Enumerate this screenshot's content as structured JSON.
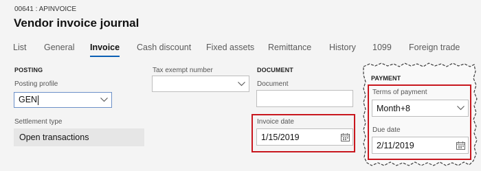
{
  "header": {
    "record_id": "00641 : APINVOICE",
    "title": "Vendor invoice journal"
  },
  "tabs": [
    {
      "label": "List",
      "active": false
    },
    {
      "label": "General",
      "active": false
    },
    {
      "label": "Invoice",
      "active": true
    },
    {
      "label": "Cash discount",
      "active": false
    },
    {
      "label": "Fixed assets",
      "active": false
    },
    {
      "label": "Remittance",
      "active": false
    },
    {
      "label": "History",
      "active": false
    },
    {
      "label": "1099",
      "active": false
    },
    {
      "label": "Foreign trade",
      "active": false
    }
  ],
  "posting": {
    "heading": "POSTING",
    "posting_profile_label": "Posting profile",
    "posting_profile_value": "GEN",
    "settlement_type_label": "Settlement type",
    "settlement_type_value": "Open transactions"
  },
  "tax": {
    "tax_exempt_label": "Tax exempt number",
    "tax_exempt_value": ""
  },
  "document": {
    "heading": "DOCUMENT",
    "document_label": "Document",
    "document_value": "",
    "invoice_date_label": "Invoice date",
    "invoice_date_value": "1/15/2019"
  },
  "payment": {
    "heading": "PAYMENT",
    "terms_label": "Terms of payment",
    "terms_value": "Month+8",
    "due_date_label": "Due date",
    "due_date_value": "2/11/2019"
  },
  "colors": {
    "highlight": "#c8161d",
    "tab_underline": "#0a5fb4"
  },
  "icons": [
    "chevron-down-icon",
    "calendar-icon"
  ]
}
